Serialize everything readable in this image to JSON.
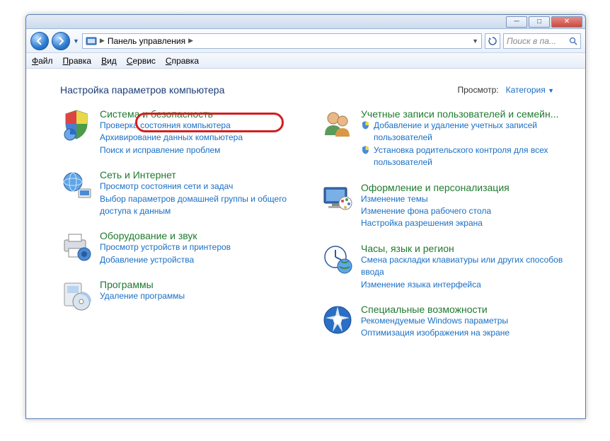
{
  "title": "Панель управления",
  "search_placeholder": "Поиск в па...",
  "menus": [
    "Файл",
    "Правка",
    "Вид",
    "Сервис",
    "Справка"
  ],
  "heading": "Настройка параметров компьютера",
  "view_label": "Просмотр:",
  "view_value": "Категория",
  "left": [
    {
      "title": "Система и безопасность",
      "links": [
        "Проверка состояния компьютера",
        "Архивирование данных компьютера",
        "Поиск и исправление проблем"
      ]
    },
    {
      "title": "Сеть и Интернет",
      "links": [
        "Просмотр состояния сети и задач",
        "Выбор параметров домашней группы и общего доступа к данным"
      ]
    },
    {
      "title": "Оборудование и звук",
      "links": [
        "Просмотр устройств и принтеров",
        "Добавление устройства"
      ]
    },
    {
      "title": "Программы",
      "links": [
        "Удаление программы"
      ]
    }
  ],
  "right": [
    {
      "title": "Учетные записи пользователей и семейн...",
      "shield_links": [
        "Добавление и удаление учетных записей пользователей",
        "Установка родительского контроля для всех пользователей"
      ],
      "links": []
    },
    {
      "title": "Оформление и персонализация",
      "links": [
        "Изменение темы",
        "Изменение фона рабочего стола",
        "Настройка разрешения экрана"
      ]
    },
    {
      "title": "Часы, язык и регион",
      "links": [
        "Смена раскладки клавиатуры или других способов ввода",
        "Изменение языка интерфейса"
      ]
    },
    {
      "title": "Специальные возможности",
      "links": [
        "Рекомендуемые Windows параметры",
        "Оптимизация изображения на экране"
      ]
    }
  ]
}
